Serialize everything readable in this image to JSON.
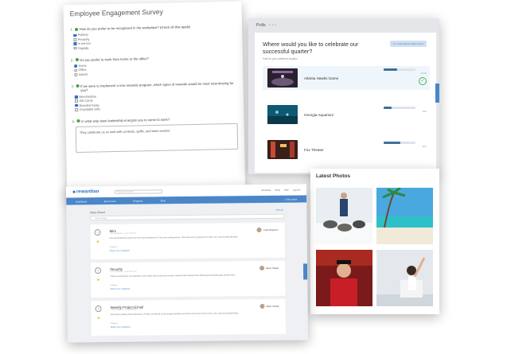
{
  "survey": {
    "title": "Employee Engagement Survey",
    "questions": [
      {
        "num": "1.",
        "text": "How do you prefer to be recognized in the workplace? (check all that apply)",
        "options": [
          {
            "label": "Publicly",
            "checked": true
          },
          {
            "label": "Privately",
            "checked": false
          },
          {
            "label": "In person",
            "checked": true
          },
          {
            "label": "Digitally",
            "checked": false
          }
        ]
      },
      {
        "num": "2.",
        "text": "Do you prefer to work from home or the office?",
        "options": [
          {
            "label": "Home",
            "checked": true
          },
          {
            "label": "Office",
            "checked": false
          },
          {
            "label": "Hybrid",
            "checked": false
          }
        ]
      },
      {
        "num": "3.",
        "text": "If we were to implement a new rewards program, which types of rewards would be most incentivizing for you?",
        "options": [
          {
            "label": "Merchandise",
            "checked": true
          },
          {
            "label": "Gift Cards",
            "checked": false
          },
          {
            "label": "Branded Swag",
            "checked": true
          },
          {
            "label": "Charitable Gifts",
            "checked": false
          }
        ]
      },
      {
        "num": "4.",
        "text": "In what way does leadership energize you to come to work?",
        "answer": "They celebrate us so well with contests, spiffs, and team events!"
      }
    ]
  },
  "polls": {
    "label": "Polls",
    "question": "Where would you like to celebrate our successful quarter?",
    "subtitle": "Vote for your preferred location",
    "button": "You voted Atlanta Hawks Game",
    "options": [
      {
        "name": "Atlanta Hawks Game",
        "percent": 0.42,
        "pct_label": "42.5%",
        "selected": true
      },
      {
        "name": "Georgia Aquarium",
        "percent": 0.25,
        "pct_label": "25%",
        "selected": false
      },
      {
        "name": "Fox Theater",
        "percent": 0.52,
        "pct_label": "52%",
        "selected": false
      }
    ]
  },
  "photos": {
    "title": "Latest Photos"
  },
  "rewardian": {
    "logo": "rewardian",
    "search_placeholder": "Search for a user",
    "top_links": [
      "Nominate",
      "Shop",
      "Help",
      "Log out"
    ],
    "nav": [
      "Dashboard",
      "My Account",
      "Programs",
      "Shop"
    ],
    "nav_right": "1,045 points",
    "ideas_title": "Ideas Board",
    "view_all": "View all",
    "search_ideas": "Search ideas",
    "ideas": [
      {
        "title": "Mini",
        "meta": "1 Good Question · June 14th 2022",
        "body": "How should Eli know what to do next since everybody is? If we ever working remote. Then there time to get plan for Further, we. Learn provide big ideas.",
        "category": "Category",
        "feedback": "Share Your Feedback",
        "user": "Justin Strayhorn"
      },
      {
        "title": "Security",
        "meta": "3 Good Question · June 14th 2022",
        "body": "I think we should give our employees 2 free weeks with our pictures on them. Need demand prepare them effectively the branding that should review.",
        "category": "Category",
        "feedback": "Share Your Feedback",
        "user": "Steve Theriap"
      },
      {
        "title": "Weekly Project Email",
        "meta": "1 Good Question · June 14th 2022",
        "body": "Send and a weekly email on Monday or Friday, covering all current project's updates and action need to be in the process. Also, any new potential ideas.",
        "category": "Category",
        "feedback": "Share Your Feedback",
        "user": "Steve Theriap"
      }
    ]
  }
}
